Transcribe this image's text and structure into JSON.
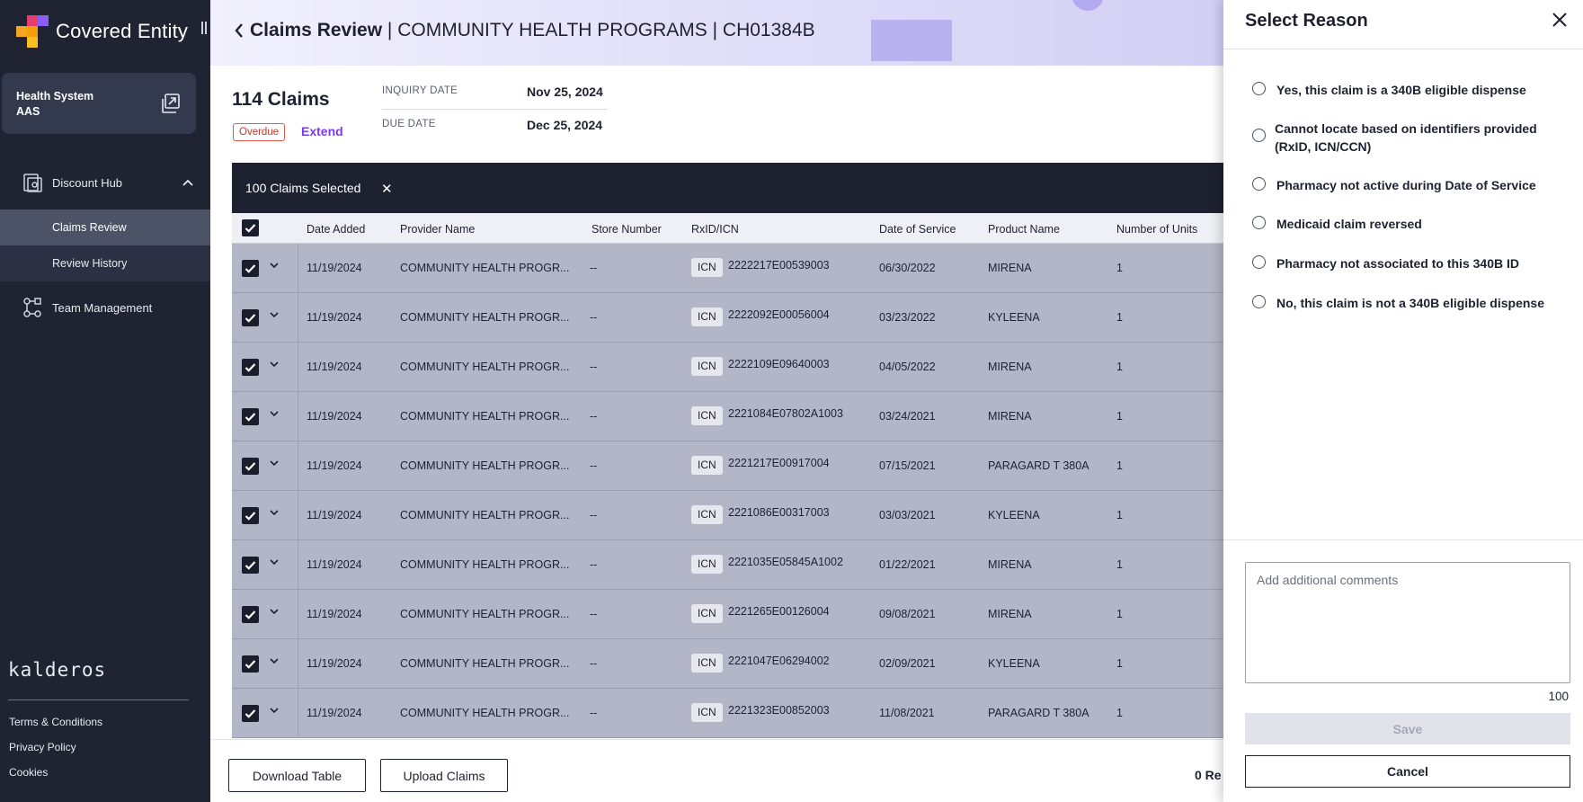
{
  "app": {
    "name": "Covered Entity"
  },
  "org": {
    "line1": "Health System",
    "line2": "AAS"
  },
  "nav": {
    "discount_hub": "Discount Hub",
    "claims_review": "Claims Review",
    "review_history": "Review History",
    "team_management": "Team Management"
  },
  "footer": {
    "brand": "kalderos",
    "terms": "Terms & Conditions",
    "privacy": "Privacy Policy",
    "cookies": "Cookies"
  },
  "header": {
    "title": "Claims Review",
    "sep1": " | ",
    "org_name": "COMMUNITY HEALTH PROGRAMS",
    "sep2": " | ",
    "entity_id": "CH01384B"
  },
  "summary": {
    "claims_count": "114 Claims",
    "status_badge": "Overdue",
    "extend": "Extend",
    "inquiry_label": "INQUIRY DATE",
    "inquiry_value": "Nov 25, 2024",
    "due_label": "DUE DATE",
    "due_value": "Dec 25, 2024"
  },
  "selection": {
    "text": "100 Claims Selected",
    "clear": "✕"
  },
  "table": {
    "columns": [
      "Date Added",
      "Provider Name",
      "Store Number",
      "RxID/ICN",
      "Date of Service",
      "Product Name",
      "Number of Units"
    ],
    "id_tag": "ICN",
    "rows": [
      {
        "date_added": "11/19/2024",
        "provider": "COMMUNITY HEALTH PROGR...",
        "store": "--",
        "rxid": "2222217E00539003",
        "dos": "06/30/2022",
        "product": "MIRENA",
        "units": "1"
      },
      {
        "date_added": "11/19/2024",
        "provider": "COMMUNITY HEALTH PROGR...",
        "store": "--",
        "rxid": "2222092E00056004",
        "dos": "03/23/2022",
        "product": "KYLEENA",
        "units": "1"
      },
      {
        "date_added": "11/19/2024",
        "provider": "COMMUNITY HEALTH PROGR...",
        "store": "--",
        "rxid": "2222109E09640003",
        "dos": "04/05/2022",
        "product": "MIRENA",
        "units": "1"
      },
      {
        "date_added": "11/19/2024",
        "provider": "COMMUNITY HEALTH PROGR...",
        "store": "--",
        "rxid": "2221084E07802A1003",
        "dos": "03/24/2021",
        "product": "MIRENA",
        "units": "1"
      },
      {
        "date_added": "11/19/2024",
        "provider": "COMMUNITY HEALTH PROGR...",
        "store": "--",
        "rxid": "2221217E00917004",
        "dos": "07/15/2021",
        "product": "PARAGARD T 380A",
        "units": "1"
      },
      {
        "date_added": "11/19/2024",
        "provider": "COMMUNITY HEALTH PROGR...",
        "store": "--",
        "rxid": "2221086E00317003",
        "dos": "03/03/2021",
        "product": "KYLEENA",
        "units": "1"
      },
      {
        "date_added": "11/19/2024",
        "provider": "COMMUNITY HEALTH PROGR...",
        "store": "--",
        "rxid": "2221035E05845A1002",
        "dos": "01/22/2021",
        "product": "MIRENA",
        "units": "1"
      },
      {
        "date_added": "11/19/2024",
        "provider": "COMMUNITY HEALTH PROGR...",
        "store": "--",
        "rxid": "2221265E00126004",
        "dos": "09/08/2021",
        "product": "MIRENA",
        "units": "1"
      },
      {
        "date_added": "11/19/2024",
        "provider": "COMMUNITY HEALTH PROGR...",
        "store": "--",
        "rxid": "2221047E06294002",
        "dos": "02/09/2021",
        "product": "KYLEENA",
        "units": "1"
      },
      {
        "date_added": "11/19/2024",
        "provider": "COMMUNITY HEALTH PROGR...",
        "store": "--",
        "rxid": "2221323E00852003",
        "dos": "11/08/2021",
        "product": "PARAGARD T 380A",
        "units": "1"
      }
    ]
  },
  "bottom": {
    "download": "Download Table",
    "upload": "Upload Claims",
    "reviewed_partial": "0 Re"
  },
  "drawer": {
    "title": "Select Reason",
    "options": [
      "Yes, this claim is a 340B eligible dispense",
      "Cannot locate based on identifiers provided (RxID, ICN/CCN)",
      "Pharmacy not active during Date of Service",
      "Medicaid claim reversed",
      "Pharmacy not associated to this 340B ID",
      "No, this claim is not a 340B eligible dispense"
    ],
    "comments_placeholder": "Add additional comments",
    "char_count": "100",
    "save": "Save",
    "cancel": "Cancel"
  },
  "icons": [
    "app-logo-icon",
    "switch-org-icon",
    "discount-hub-icon",
    "chevron-up-icon",
    "team-icon",
    "back-chevron-icon",
    "close-icon",
    "checkbox-checked-icon",
    "row-expand-chevron-icon"
  ],
  "colors": {
    "sidebar": "#1f2332",
    "accent": "#7c3aed",
    "overdue": "#c0392b",
    "row_selected": "#b3b6c6",
    "selection_bar": "#1e2230"
  }
}
